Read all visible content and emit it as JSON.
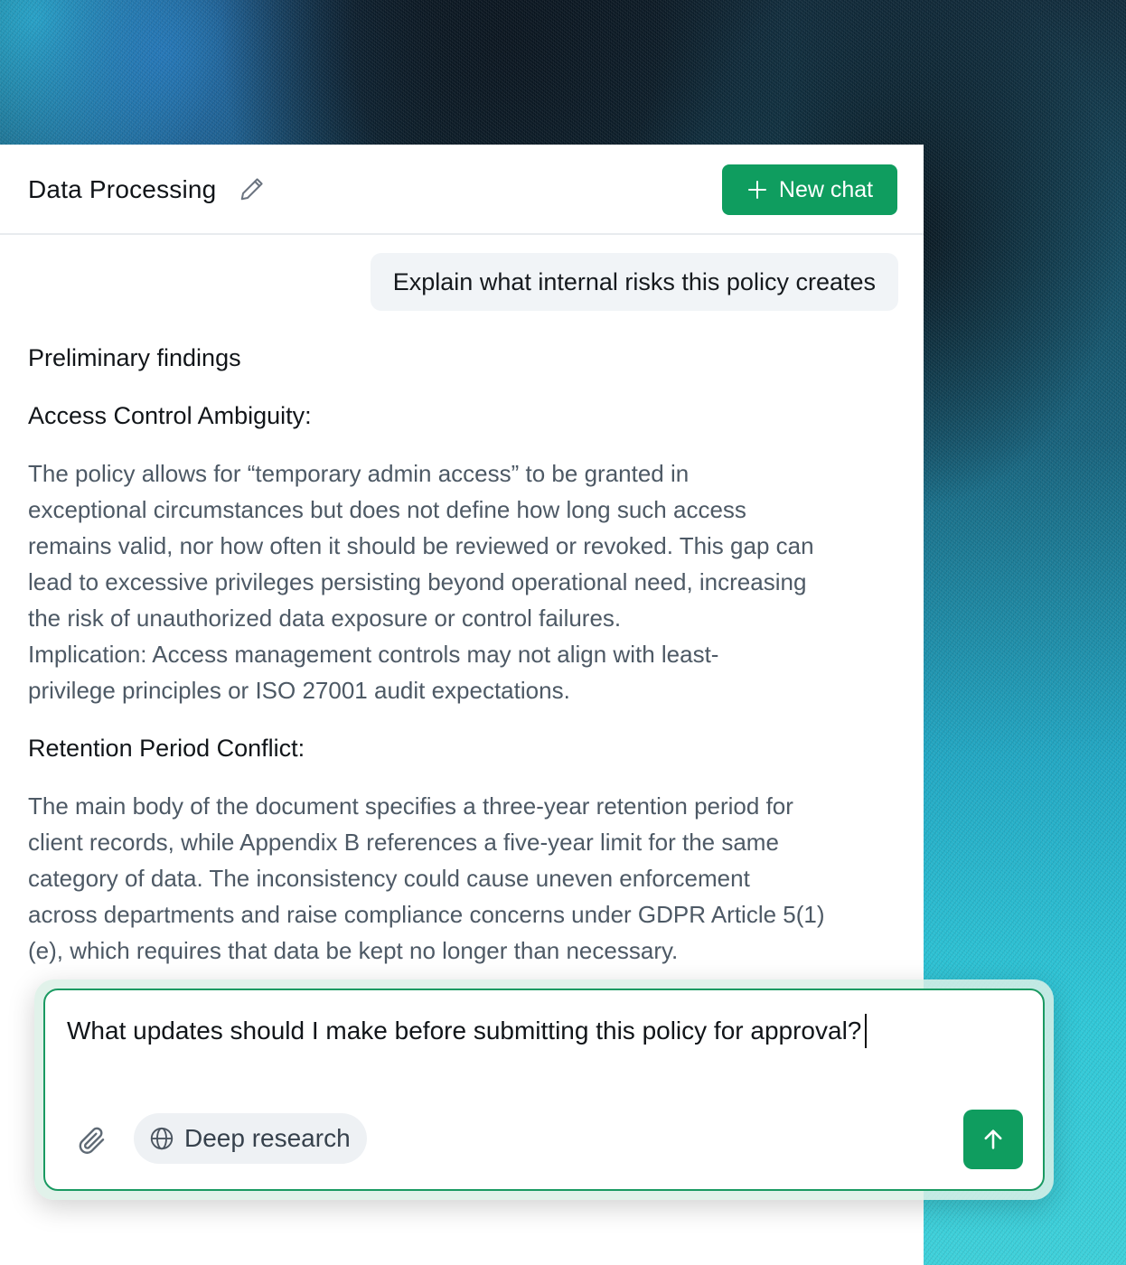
{
  "header": {
    "title": "Data Processing",
    "new_chat_label": "New chat"
  },
  "user_message": "Explain what internal risks this policy creates",
  "answer": {
    "heading": "Preliminary findings",
    "sections": [
      {
        "title": "Access Control Ambiguity:",
        "body": [
          "The policy allows for “temporary admin access” to be granted in",
          "exceptional circumstances but does not define how long such access",
          "remains valid, nor how often it should be reviewed or revoked. This gap can",
          "lead to excessive privileges persisting beyond operational need, increasing",
          "the risk of unauthorized data exposure or control failures.",
          "Implication: Access management controls may not align with least-",
          "privilege principles or ISO 27001 audit expectations."
        ]
      },
      {
        "title": "Retention Period Conflict:",
        "body": [
          "The main body of the document specifies a three-year retention period for",
          "client records, while Appendix B references a five-year limit for the same",
          "category of data. The inconsistency could cause uneven enforcement",
          "across departments and raise compliance concerns under GDPR Article 5(1)",
          "(e), which requires that data be kept no longer than necessary."
        ]
      }
    ]
  },
  "composer": {
    "text": "What updates should I make before submitting this policy for approval?",
    "deep_research_label": "Deep research"
  },
  "icons": {
    "edit": "pencil-icon",
    "new_chat": "plus-icon",
    "attach": "paperclip-icon",
    "deep_research": "globe-icon",
    "send": "arrow-up-icon"
  },
  "colors": {
    "accent": "#0f9d5f",
    "bubble": "#f1f4f7",
    "body_text": "#4d5965"
  }
}
